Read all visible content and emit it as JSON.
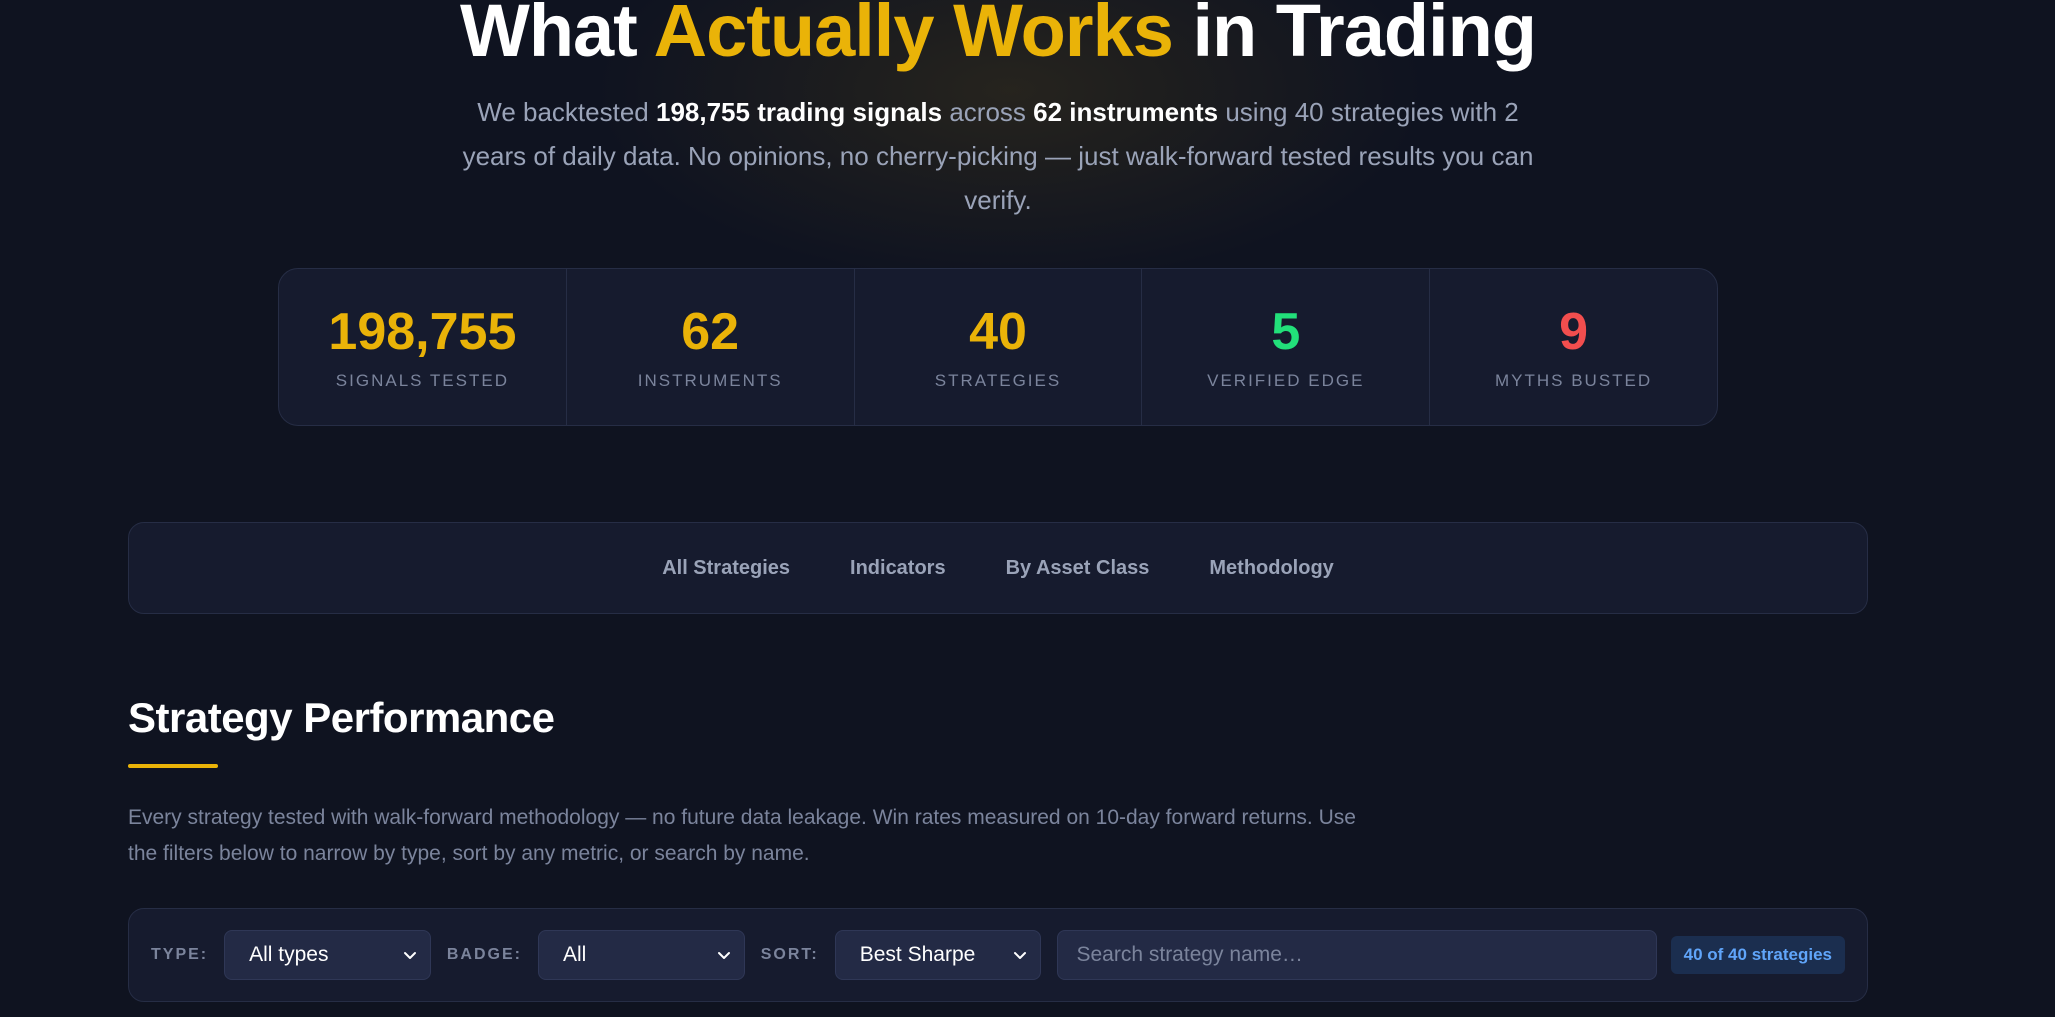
{
  "hero": {
    "title_pre": "What ",
    "title_accent": "Actually Works",
    "title_post": " in Trading",
    "sub_1": "We backtested ",
    "sub_2": "198,755 trading signals",
    "sub_3": " across ",
    "sub_4": "62 instruments",
    "sub_5": " using 40 strategies with 2 years of daily data. No opinions, no cherry-picking — just walk-forward tested results you can verify."
  },
  "stats": [
    {
      "value": "198,755",
      "label": "SIGNALS TESTED",
      "color": "#eab308"
    },
    {
      "value": "62",
      "label": "INSTRUMENTS",
      "color": "#eab308"
    },
    {
      "value": "40",
      "label": "STRATEGIES",
      "color": "#eab308"
    },
    {
      "value": "5",
      "label": "VERIFIED EDGE",
      "color": "#22e07a"
    },
    {
      "value": "9",
      "label": "MYTHS BUSTED",
      "color": "#f24e4e"
    }
  ],
  "tabs": [
    "All Strategies",
    "Indicators",
    "By Asset Class",
    "Methodology"
  ],
  "section": {
    "title": "Strategy Performance",
    "desc": "Every strategy tested with walk-forward methodology — no future data leakage. Win rates measured on 10-day forward returns. Use the filters below to narrow by type, sort by any metric, or search by name."
  },
  "filters": {
    "type_label": "TYPE:",
    "type_value": "All types",
    "badge_label": "BADGE:",
    "badge_value": "All",
    "sort_label": "SORT:",
    "sort_value": "Best Sharpe",
    "search_placeholder": "Search strategy name…",
    "count": "40 of 40 strategies"
  },
  "colors": {
    "accent": "#eab308",
    "positive": "#22e07a",
    "negative": "#f24e4e",
    "info": "#60a5fa"
  }
}
